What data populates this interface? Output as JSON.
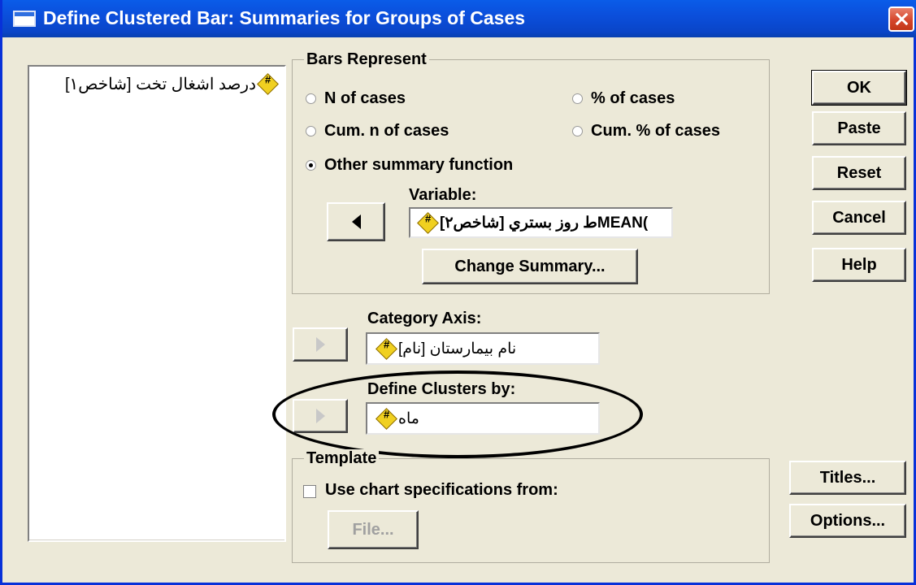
{
  "window": {
    "title": "Define Clustered Bar: Summaries for Groups of Cases"
  },
  "source_list": {
    "items": [
      {
        "label": "درصد اشغال تخت [شاخص۱]",
        "icon": "scale-variable-icon"
      }
    ]
  },
  "bars_represent": {
    "title": "Bars Represent",
    "options": [
      {
        "label": "N of cases",
        "checked": false
      },
      {
        "label": "% of cases",
        "checked": false
      },
      {
        "label": "Cum. n of cases",
        "checked": false
      },
      {
        "label": "Cum. % of cases",
        "checked": false
      },
      {
        "label": "Other summary function",
        "checked": true
      }
    ],
    "variable_label": "Variable:",
    "variable_value": "ط روز بستري [شاخص۲]MEAN(",
    "change_summary_label": "Change Summary..."
  },
  "category_axis": {
    "label": "Category Axis:",
    "value": "نام بيمارستان [نام]"
  },
  "define_clusters": {
    "label": "Define Clusters by:",
    "value": "ماه"
  },
  "template": {
    "title": "Template",
    "checkbox_label": "Use chart specifications from:",
    "checkbox_checked": false,
    "file_button": "File..."
  },
  "buttons": {
    "ok": "OK",
    "paste": "Paste",
    "reset": "Reset",
    "cancel": "Cancel",
    "help": "Help",
    "titles": "Titles...",
    "options": "Options..."
  },
  "colors": {
    "titlebar": "#0a5ce8",
    "dialog_bg": "#ece9d8",
    "close": "#d5462c",
    "highlight_ellipse": "#000000"
  }
}
